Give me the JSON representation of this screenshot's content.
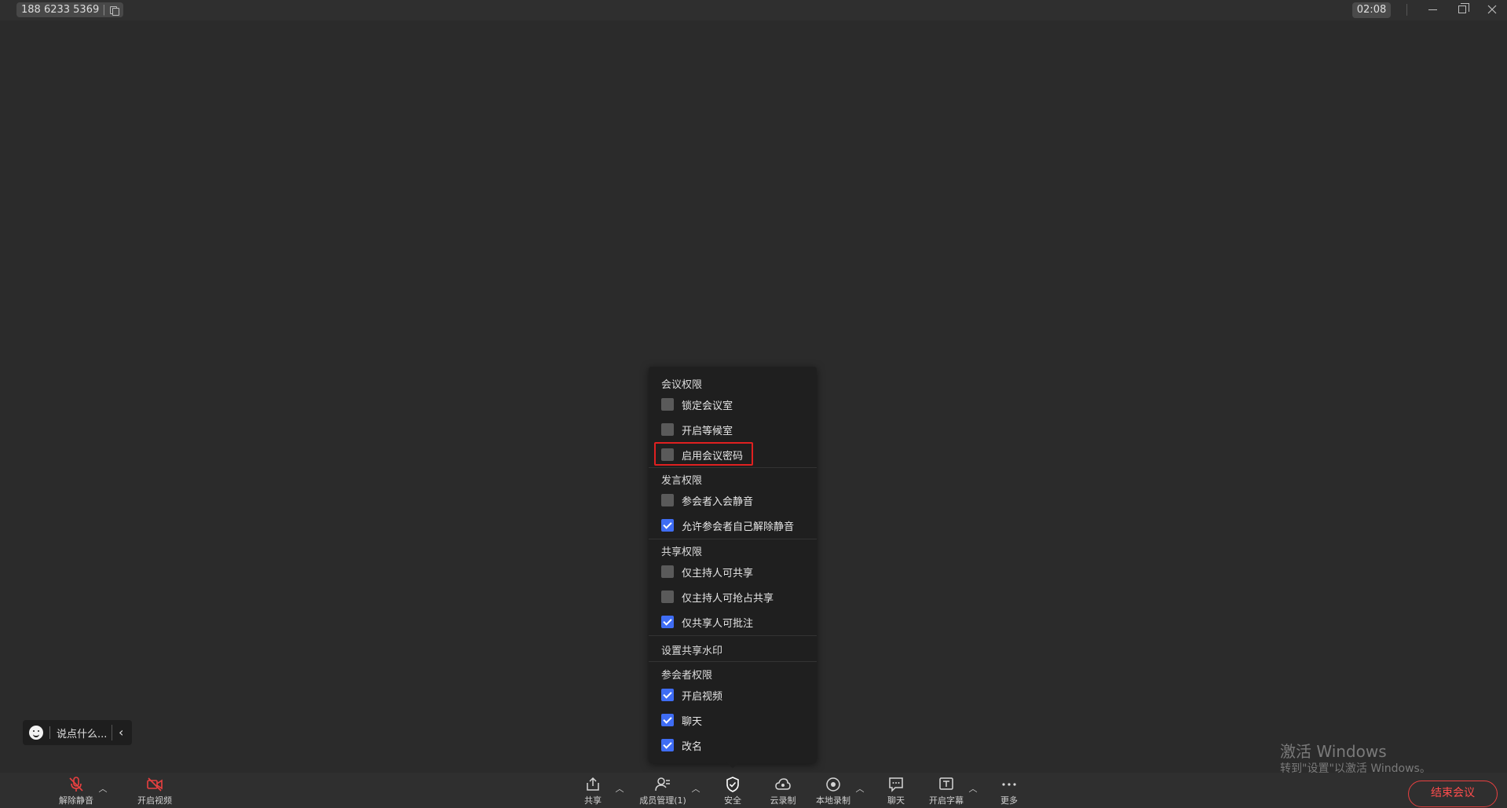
{
  "titlebar": {
    "meeting_id": "188 6233 5369",
    "timer": "02:08"
  },
  "chat_pill": {
    "placeholder": "说点什么..."
  },
  "security_popup": {
    "sections": [
      {
        "title": "会议权限",
        "options": [
          {
            "label": "锁定会议室",
            "checked": false
          },
          {
            "label": "开启等候室",
            "checked": false
          },
          {
            "label": "启用会议密码",
            "checked": false,
            "highlighted": true
          }
        ]
      },
      {
        "title": "发言权限",
        "options": [
          {
            "label": "参会者入会静音",
            "checked": false
          },
          {
            "label": "允许参会者自己解除静音",
            "checked": true
          }
        ]
      },
      {
        "title": "共享权限",
        "options": [
          {
            "label": "仅主持人可共享",
            "checked": false
          },
          {
            "label": "仅主持人可抢占共享",
            "checked": false
          },
          {
            "label": "仅共享人可批注",
            "checked": true
          }
        ]
      },
      {
        "title": "设置共享水印",
        "options": []
      },
      {
        "title": "参会者权限",
        "options": [
          {
            "label": "开启视频",
            "checked": true
          },
          {
            "label": "聊天",
            "checked": true
          },
          {
            "label": "改名",
            "checked": true
          }
        ]
      }
    ]
  },
  "watermark": {
    "title": "激活 Windows",
    "subtitle": "转到\"设置\"以激活 Windows。"
  },
  "toolbar": {
    "unmute": "解除静音",
    "start_video": "开启视频",
    "share": "共享",
    "members": "成员管理(1)",
    "security": "安全",
    "cloud_record": "云录制",
    "local_record": "本地录制",
    "chat": "聊天",
    "captions": "开启字幕",
    "more": "更多",
    "end_meeting": "结束会议"
  },
  "colors": {
    "accent_blue": "#3f6df4",
    "danger_red": "#e94040",
    "background": "#2b2b2b"
  }
}
